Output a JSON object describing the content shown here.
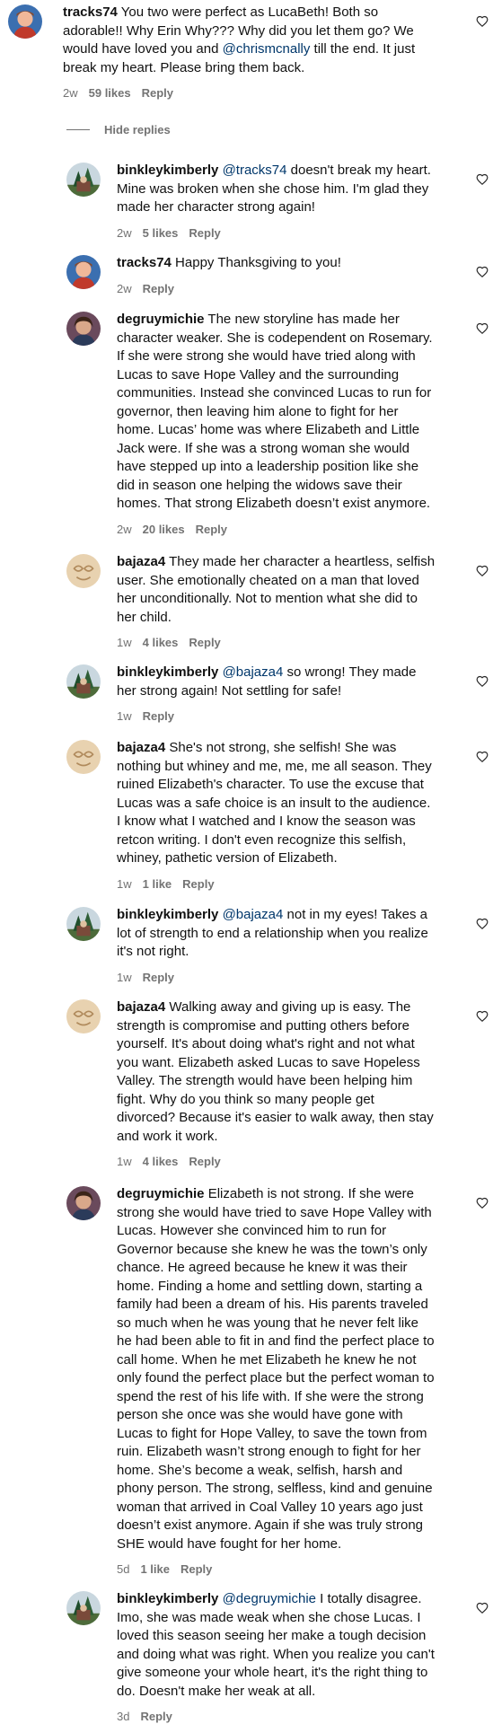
{
  "hide_replies_label": "Hide replies",
  "comments": [
    {
      "username": "tracks74",
      "segments": [
        " You two were perfect as LucaBeth! Both so adorable!! Why Erin Why??? Why did you let them go? We would have loved you and ",
        {
          "mention": "@chrismcnally"
        },
        " till the end. It just break my heart. Please bring them back."
      ],
      "time": "2w",
      "likes": "59 likes",
      "reply": "Reply",
      "avatar": "tracks74-avatar"
    },
    {
      "username": "binkleykimberly",
      "segments": [
        " ",
        {
          "mention": "@tracks74"
        },
        " doesn't break my heart. Mine was broken when she chose him. I'm glad they made her character strong again!"
      ],
      "time": "2w",
      "likes": "5 likes",
      "reply": "Reply",
      "avatar": "binkleykimberly-avatar"
    },
    {
      "username": "tracks74",
      "segments": [
        " Happy Thanksgiving to you!"
      ],
      "time": "2w",
      "likes": "",
      "reply": "Reply",
      "avatar": "tracks74-avatar"
    },
    {
      "username": "degruymichie",
      "segments": [
        " The new storyline has made her character weaker. She is codependent on Rosemary. If she were strong she would have tried along with Lucas to save Hope Valley and the surrounding communities. Instead she convinced Lucas to run for governor, then leaving him alone to fight for her home. Lucas’ home was where Elizabeth and Little Jack were. If she was a strong woman she would have stepped up into a leadership position like she did in season one helping the widows save their homes. That strong Elizabeth doesn’t exist anymore."
      ],
      "time": "2w",
      "likes": "20 likes",
      "reply": "Reply",
      "avatar": "degruymichie-avatar"
    },
    {
      "username": "bajaza4",
      "segments": [
        " They made her character a heartless, selfish user. She emotionally cheated on a man that loved her unconditionally. Not to mention what she did to her child."
      ],
      "time": "1w",
      "likes": "4 likes",
      "reply": "Reply",
      "avatar": "bajaza4-avatar"
    },
    {
      "username": "binkleykimberly",
      "segments": [
        " ",
        {
          "mention": "@bajaza4"
        },
        " so wrong! They made her strong again! Not settling for safe!"
      ],
      "time": "1w",
      "likes": "",
      "reply": "Reply",
      "avatar": "binkleykimberly-avatar"
    },
    {
      "username": "bajaza4",
      "segments": [
        " She's not strong, she selfish! She was nothing but whiney and me, me, me all season. They ruined Elizabeth's character. To use the excuse that Lucas was a safe choice is an insult to the audience. I know what I watched and I know the season was retcon writing. I don't even recognize this selfish, whiney, pathetic version of Elizabeth."
      ],
      "time": "1w",
      "likes": "1 like",
      "reply": "Reply",
      "avatar": "bajaza4-avatar"
    },
    {
      "username": "binkleykimberly",
      "segments": [
        " ",
        {
          "mention": "@bajaza4"
        },
        " not in my eyes! Takes a lot of strength to end a relationship when you realize it's not right."
      ],
      "time": "1w",
      "likes": "",
      "reply": "Reply",
      "avatar": "binkleykimberly-avatar"
    },
    {
      "username": "bajaza4",
      "segments": [
        " Walking away and giving up is easy. The strength is compromise and putting others before yourself. It's about doing what's right and not what you want. Elizabeth asked Lucas to save Hopeless Valley. The strength would have been helping him fight. Why do you think so many people get divorced? Because it's easier to walk away, then stay and work it work."
      ],
      "time": "1w",
      "likes": "4 likes",
      "reply": "Reply",
      "avatar": "bajaza4-avatar"
    },
    {
      "username": "degruymichie",
      "segments": [
        " Elizabeth is not strong. If she were strong she would have tried to save Hope Valley with Lucas. However she convinced him to run for Governor because she knew he was the town’s only chance. He agreed because he knew it was their home. Finding a home and settling down, starting a family had been a dream of his. His parents traveled so much when he was young that he never felt like he had been able to fit in and find the perfect place to call home. When he met Elizabeth he knew he not only found the perfect place but the perfect woman to spend the rest of his life with. If she were the strong person she once was she would have gone with Lucas to fight for Hope Valley, to save the town from ruin. Elizabeth wasn’t strong enough to fight for her home. She’s become a weak, selfish, harsh and phony person. The strong, selfless, kind and genuine woman that arrived in Coal Valley 10 years ago just doesn’t exist anymore. Again if she was truly strong SHE would have fought for her home."
      ],
      "time": "5d",
      "likes": "1 like",
      "reply": "Reply",
      "avatar": "degruymichie-avatar"
    },
    {
      "username": "binkleykimberly",
      "segments": [
        " ",
        {
          "mention": "@degruymichie"
        },
        " I totally disagree. Imo, she was made weak when she chose Lucas. I loved this season seeing her make a tough decision and doing what was right. When you realize you can't give someone your whole heart, it's the right thing to do. Doesn't make her weak at all."
      ],
      "time": "3d",
      "likes": "",
      "reply": "Reply",
      "avatar": "binkleykimberly-avatar"
    }
  ]
}
